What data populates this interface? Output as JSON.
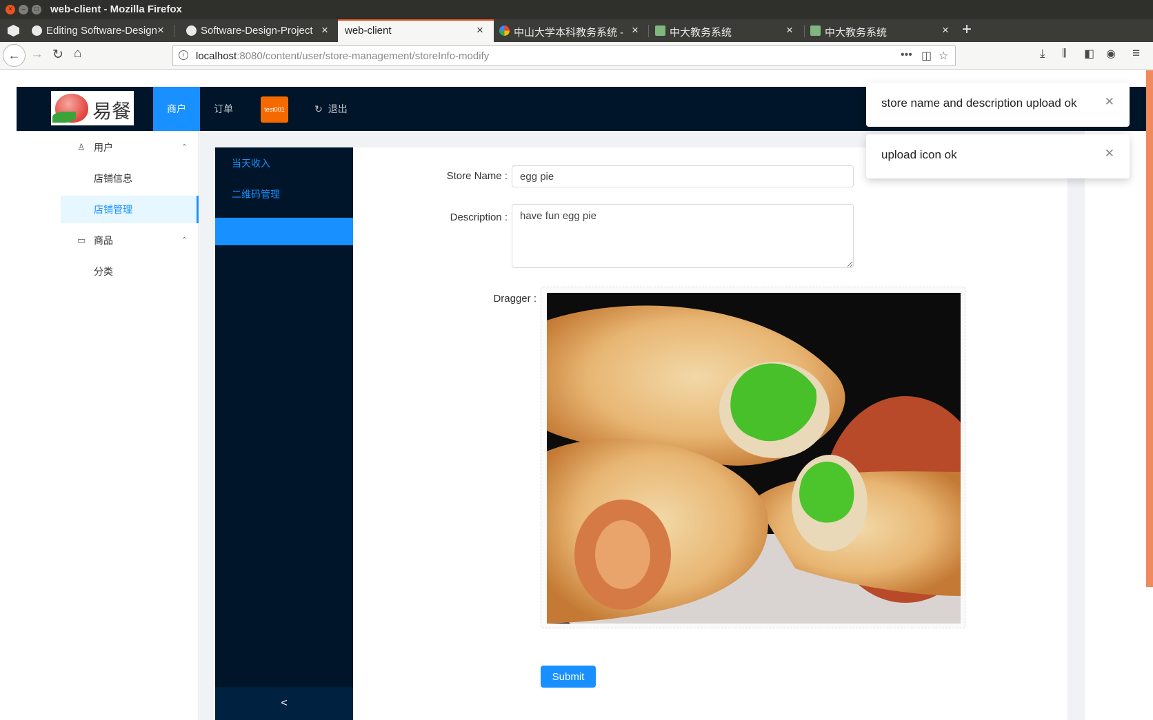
{
  "window": {
    "title": "web-client - Mozilla Firefox",
    "tabs": [
      {
        "label": "Editing Software-Design-Project",
        "icon": "github-icon"
      },
      {
        "label": "Software-Design-Project",
        "icon": "github-icon"
      },
      {
        "label": "web-client",
        "active": true
      },
      {
        "label": "中山大学本科教务系统 - Google",
        "icon": "google-icon"
      },
      {
        "label": "中大教务系统",
        "icon": "sysu-icon"
      },
      {
        "label": "中大教务系统",
        "icon": "sysu-icon"
      }
    ],
    "url_host": "localhost",
    "url_path": ":8080/content/user/store-management/storeInfo-modify"
  },
  "header": {
    "logo_text": "易餐",
    "nav_merchant": "商户",
    "nav_orders": "订单",
    "user_badge": "test001",
    "nav_logout": "退出"
  },
  "left_menu": {
    "group_user": "用户",
    "item_store_info": "店铺信息",
    "item_store_manage": "店铺管理",
    "group_goods": "商品",
    "item_category": "分类"
  },
  "sider": {
    "item_income": "当天收入",
    "item_qrcode": "二维码管理",
    "collapse": "<"
  },
  "form": {
    "store_name_label": "Store Name",
    "store_name_value": "egg pie",
    "description_label": "Description",
    "description_value": "have fun egg pie",
    "dragger_label": "Dragger",
    "submit_label": "Submit"
  },
  "notifications": [
    {
      "text": "store name and description upload ok"
    },
    {
      "text": "upload icon ok"
    }
  ],
  "colors": {
    "header_bg": "#001529",
    "primary": "#1890ff",
    "badge": "#f56a00",
    "tab_accent": "#e95420"
  }
}
